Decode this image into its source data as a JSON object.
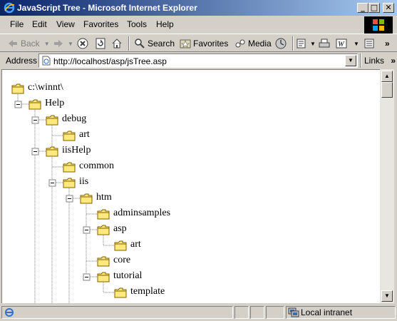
{
  "window": {
    "title": "JavaScript Tree - Microsoft Internet Explorer",
    "controls": {
      "minimize": "_",
      "maximize": "□",
      "close": "✕"
    }
  },
  "menu": [
    "File",
    "Edit",
    "View",
    "Favorites",
    "Tools",
    "Help"
  ],
  "toolbar": {
    "back_label": "Back",
    "search_label": "Search",
    "favorites_label": "Favorites",
    "media_label": "Media",
    "chevron": "»"
  },
  "address": {
    "label": "Address",
    "url": "http://localhost/asp/jsTree.asp",
    "links_label": "Links",
    "links_chevron": "»"
  },
  "tree": {
    "nodes": [
      {
        "label": "c:\\winnt\\",
        "depth": 0,
        "toggle": "none"
      },
      {
        "label": "Help",
        "depth": 1,
        "toggle": "minus"
      },
      {
        "label": "debug",
        "depth": 2,
        "toggle": "minus"
      },
      {
        "label": "art",
        "depth": 3,
        "toggle": "none"
      },
      {
        "label": "iisHelp",
        "depth": 2,
        "toggle": "minus"
      },
      {
        "label": "common",
        "depth": 3,
        "toggle": "none"
      },
      {
        "label": "iis",
        "depth": 3,
        "toggle": "minus"
      },
      {
        "label": "htm",
        "depth": 4,
        "toggle": "minus"
      },
      {
        "label": "adminsamples",
        "depth": 5,
        "toggle": "none"
      },
      {
        "label": "asp",
        "depth": 5,
        "toggle": "minus"
      },
      {
        "label": "art",
        "depth": 6,
        "toggle": "none"
      },
      {
        "label": "core",
        "depth": 5,
        "toggle": "none"
      },
      {
        "label": "tutorial",
        "depth": 5,
        "toggle": "minus"
      },
      {
        "label": "template",
        "depth": 6,
        "toggle": "none"
      }
    ]
  },
  "status": {
    "zone_label": "Local intranet"
  },
  "colors": {
    "folder_fill": "#ffe87c",
    "folder_stroke": "#806000",
    "title_start": "#0a246a",
    "title_end": "#a6caf0"
  }
}
